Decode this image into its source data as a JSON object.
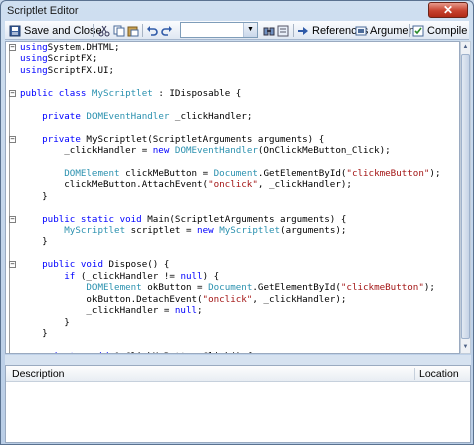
{
  "window": {
    "title": "Scriptlet Editor",
    "close_label": "✕"
  },
  "toolbar": {
    "save_close_label": "Save and Close",
    "references_label": "References",
    "arguments_label": "Arguments",
    "compile_label": "Compile",
    "combo_value": ""
  },
  "code_lines": [
    [
      [
        "kw",
        "using"
      ],
      [
        "",
        "System.DHTML;"
      ]
    ],
    [
      [
        "kw",
        "using"
      ],
      [
        "",
        "ScriptFX;"
      ]
    ],
    [
      [
        "kw",
        "using"
      ],
      [
        "",
        "ScriptFX.UI;"
      ]
    ],
    [],
    [
      [
        "kw",
        "public class "
      ],
      [
        "ty",
        "MyScriptlet"
      ],
      [
        "",
        " : IDisposable {"
      ]
    ],
    [],
    [
      [
        "",
        "    "
      ],
      [
        "kw",
        "private "
      ],
      [
        "ty",
        "DOMEventHandler"
      ],
      [
        "",
        " _clickHandler;"
      ]
    ],
    [],
    [
      [
        "",
        "    "
      ],
      [
        "kw",
        "private "
      ],
      [
        "",
        "MyScriptlet(ScriptletArguments arguments) {"
      ]
    ],
    [
      [
        "",
        "        _clickHandler = "
      ],
      [
        "kw",
        "new "
      ],
      [
        "ty",
        "DOMEventHandler"
      ],
      [
        "",
        "(OnClickMeButton_Click);"
      ]
    ],
    [],
    [
      [
        "",
        "        "
      ],
      [
        "ty",
        "DOMElement"
      ],
      [
        "",
        " clickMeButton = "
      ],
      [
        "ty",
        "Document"
      ],
      [
        "",
        ".GetElementById("
      ],
      [
        "str",
        "\"clickmeButton\""
      ],
      [
        "",
        ");"
      ]
    ],
    [
      [
        "",
        "        clickMeButton.AttachEvent("
      ],
      [
        "str",
        "\"onclick\""
      ],
      [
        "",
        ", _clickHandler);"
      ]
    ],
    [
      [
        "",
        "    }"
      ]
    ],
    [],
    [
      [
        "",
        "    "
      ],
      [
        "kw",
        "public static void "
      ],
      [
        "",
        "Main(ScriptletArguments arguments) {"
      ]
    ],
    [
      [
        "",
        "        "
      ],
      [
        "ty",
        "MyScriptlet"
      ],
      [
        "",
        " scriptlet = "
      ],
      [
        "kw",
        "new "
      ],
      [
        "ty",
        "MyScriptlet"
      ],
      [
        "",
        "(arguments);"
      ]
    ],
    [
      [
        "",
        "    }"
      ]
    ],
    [],
    [
      [
        "",
        "    "
      ],
      [
        "kw",
        "public void "
      ],
      [
        "",
        "Dispose() {"
      ]
    ],
    [
      [
        "",
        "        "
      ],
      [
        "kw",
        "if "
      ],
      [
        "",
        "(_clickHandler != "
      ],
      [
        "kw",
        "null"
      ],
      [
        "",
        ") {"
      ]
    ],
    [
      [
        "",
        "            "
      ],
      [
        "ty",
        "DOMElement"
      ],
      [
        "",
        " okButton = "
      ],
      [
        "ty",
        "Document"
      ],
      [
        "",
        ".GetElementById("
      ],
      [
        "str",
        "\"clickmeButton\""
      ],
      [
        "",
        ");"
      ]
    ],
    [
      [
        "",
        "            okButton.DetachEvent("
      ],
      [
        "str",
        "\"onclick\""
      ],
      [
        "",
        ", _clickHandler);"
      ]
    ],
    [
      [
        "",
        "            _clickHandler = "
      ],
      [
        "kw",
        "null"
      ],
      [
        "",
        ";"
      ]
    ],
    [
      [
        "",
        "        }"
      ]
    ],
    [
      [
        "",
        "    }"
      ]
    ],
    [],
    [
      [
        "",
        "    "
      ],
      [
        "kw",
        "private void "
      ],
      [
        "",
        "OnClickMeButton_Click() {"
      ]
    ]
  ],
  "error_list": {
    "description_label": "Description",
    "location_label": "Location"
  },
  "colors": {
    "keyword": "#0000ff",
    "type": "#2b91af",
    "string": "#a31515"
  }
}
